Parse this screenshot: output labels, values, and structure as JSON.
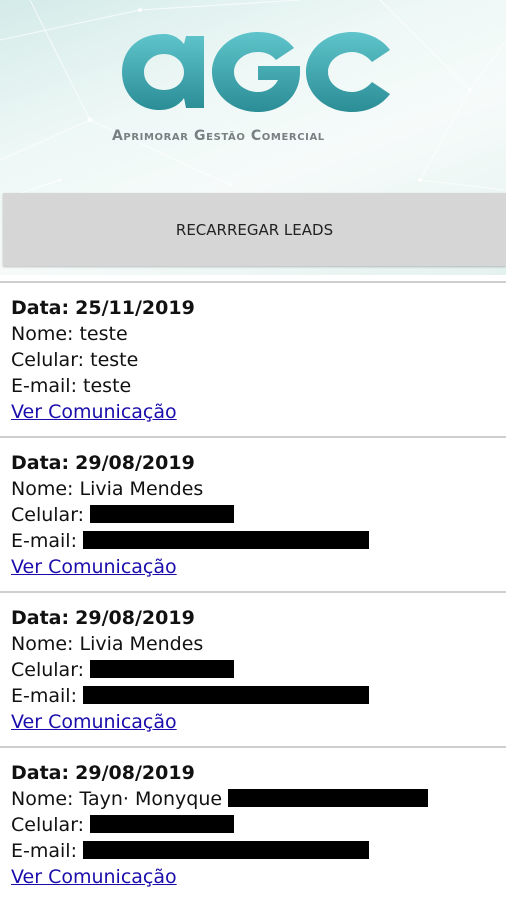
{
  "header": {
    "logo_text": "AGC",
    "tagline": "Aprimorar Gestão Comercial"
  },
  "reload_button": {
    "label": "RECARREGAR LEADS"
  },
  "leads": [
    {
      "date_label": "Data:",
      "date": "25/11/2019",
      "name_label": "Nome:",
      "name": "teste",
      "phone_label": "Celular:",
      "phone": "teste",
      "email_label": "E-mail:",
      "email": "teste",
      "link": "Ver Comunicação"
    },
    {
      "date_label": "Data:",
      "date": "29/08/2019",
      "name_label": "Nome:",
      "name": "Livia Mendes",
      "phone_label": "Celular:",
      "phone": "",
      "email_label": "E-mail:",
      "email": "",
      "link": "Ver Comunicação"
    },
    {
      "date_label": "Data:",
      "date": "29/08/2019",
      "name_label": "Nome:",
      "name": "Livia Mendes",
      "phone_label": "Celular:",
      "phone": "",
      "email_label": "E-mail:",
      "email": "",
      "link": "Ver Comunicação"
    },
    {
      "date_label": "Data:",
      "date": "29/08/2019",
      "name_label": "Nome:",
      "name": "Tayn· Monyque",
      "phone_label": "Celular:",
      "phone": "",
      "email_label": "E-mail:",
      "email": "",
      "link": "Ver Comunicação"
    }
  ],
  "colors": {
    "logo": "#3fa9b1",
    "link": "#1a0dab",
    "button": "#d6d6d6"
  }
}
